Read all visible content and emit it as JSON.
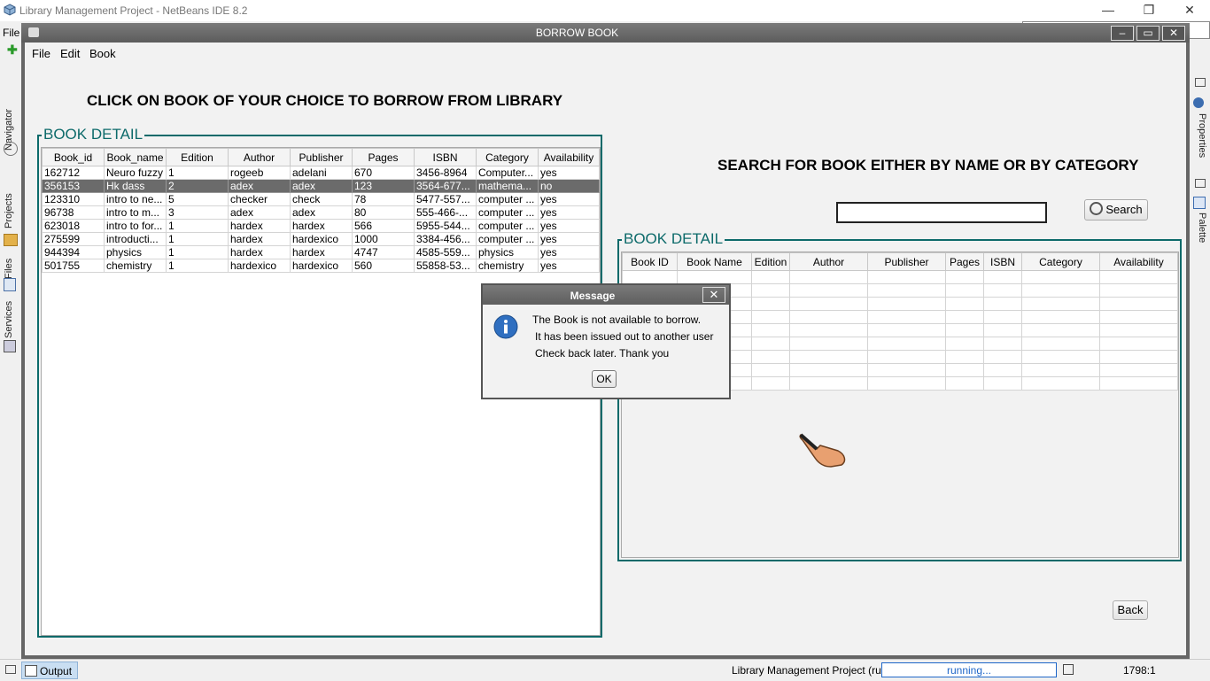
{
  "ide": {
    "title": "Library Management Project - NetBeans IDE 8.2",
    "menu_partial": "File",
    "left_tabs": [
      "Navigator",
      "Projects",
      "Files",
      "Services"
    ],
    "right_tabs": [
      "Properties",
      "Palette"
    ],
    "output_tab": "Output",
    "status": "Library Management Project (run)",
    "progress_label": "running...",
    "position": "1798:1"
  },
  "window": {
    "title": "BORROW BOOK",
    "menu": [
      "File",
      "Edit",
      "Book"
    ],
    "heading": "CLICK ON BOOK OF YOUR CHOICE TO BORROW FROM LIBRARY",
    "search_heading": "SEARCH FOR BOOK EITHER BY NAME OR BY CATEGORY",
    "search_value": "",
    "search_button": "Search",
    "back_button": "Back"
  },
  "left_table": {
    "group_title": "BOOK DETAIL",
    "columns": [
      "Book_id",
      "Book_name",
      "Edition",
      "Author",
      "Publisher",
      "Pages",
      "ISBN",
      "Category",
      "Availability"
    ],
    "selected_row": 1,
    "rows": [
      [
        "162712",
        "Neuro fuzzy",
        "1",
        "rogeeb",
        "adelani",
        "670",
        "3456-8964",
        "Computer...",
        "yes"
      ],
      [
        "356153",
        "Hk dass",
        "2",
        "adex",
        "adex",
        "123",
        "3564-677...",
        "mathema...",
        "no"
      ],
      [
        "123310",
        "intro to ne...",
        "5",
        "checker",
        "check",
        "78",
        "5477-557...",
        "computer ...",
        "yes"
      ],
      [
        "96738",
        "intro to m...",
        "3",
        "adex",
        "adex",
        "80",
        "555-466-...",
        "computer ...",
        "yes"
      ],
      [
        "623018",
        "intro to for...",
        "1",
        "hardex",
        "hardex",
        "566",
        "5955-544...",
        "computer ...",
        "yes"
      ],
      [
        "275599",
        "introducti...",
        "1",
        "hardex",
        "hardexico",
        "1000",
        "3384-456...",
        "computer ...",
        "yes"
      ],
      [
        "944394",
        "physics",
        "1",
        "hardex",
        "hardex",
        "4747",
        "4585-559...",
        "physics",
        "yes"
      ],
      [
        "501755",
        "chemistry",
        "1",
        "hardexico",
        "hardexico",
        "560",
        "55858-53...",
        "chemistry",
        "yes"
      ]
    ]
  },
  "right_table": {
    "group_title": "BOOK DETAIL",
    "columns": [
      "Book ID",
      "Book Name",
      "Edition",
      "Author",
      "Publisher",
      "Pages",
      "ISBN",
      "Category",
      "Availability"
    ],
    "empty_rows": 9
  },
  "dialog": {
    "title": "Message",
    "lines": [
      "The Book is not available to borrow.",
      "It has been issued out to another user",
      "Check back later. Thank you"
    ],
    "ok_label": "OK",
    "icon": "info-icon"
  },
  "colors": {
    "accent": "#0c6a6a",
    "selection": "#6b6b6b",
    "progress": "#1e66c8"
  }
}
